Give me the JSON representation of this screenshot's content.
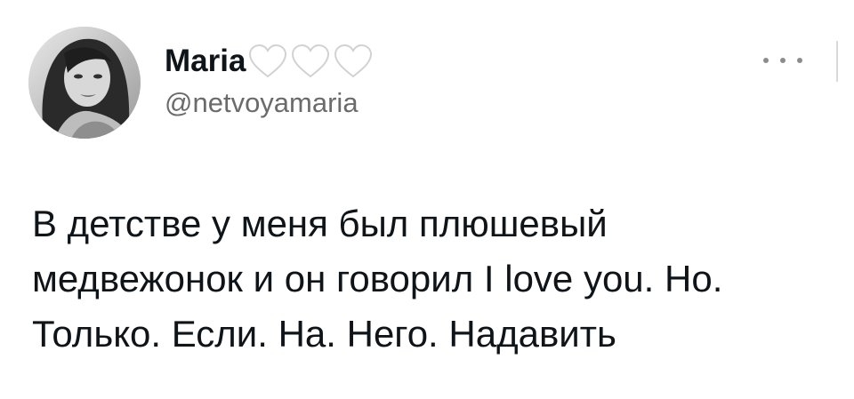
{
  "author": {
    "display_name": "Maria",
    "handle": "@netvoyamaria",
    "hearts": [
      "white-heart-icon",
      "white-heart-icon",
      "white-heart-icon"
    ],
    "avatar": "profile-photo"
  },
  "menu": {
    "more_icon": "more-horizontal-icon"
  },
  "tweet": {
    "lines": [
      "В детстве у меня был плюшевый",
      "медвежонок и он говорил I love you. Но.",
      "Только. Если. На. Него. Надавить"
    ]
  },
  "colors": {
    "text": "#0f1419",
    "secondary": "#6b6b6b",
    "heart_fill": "#ffffff",
    "heart_stroke": "#d2d2d2"
  }
}
